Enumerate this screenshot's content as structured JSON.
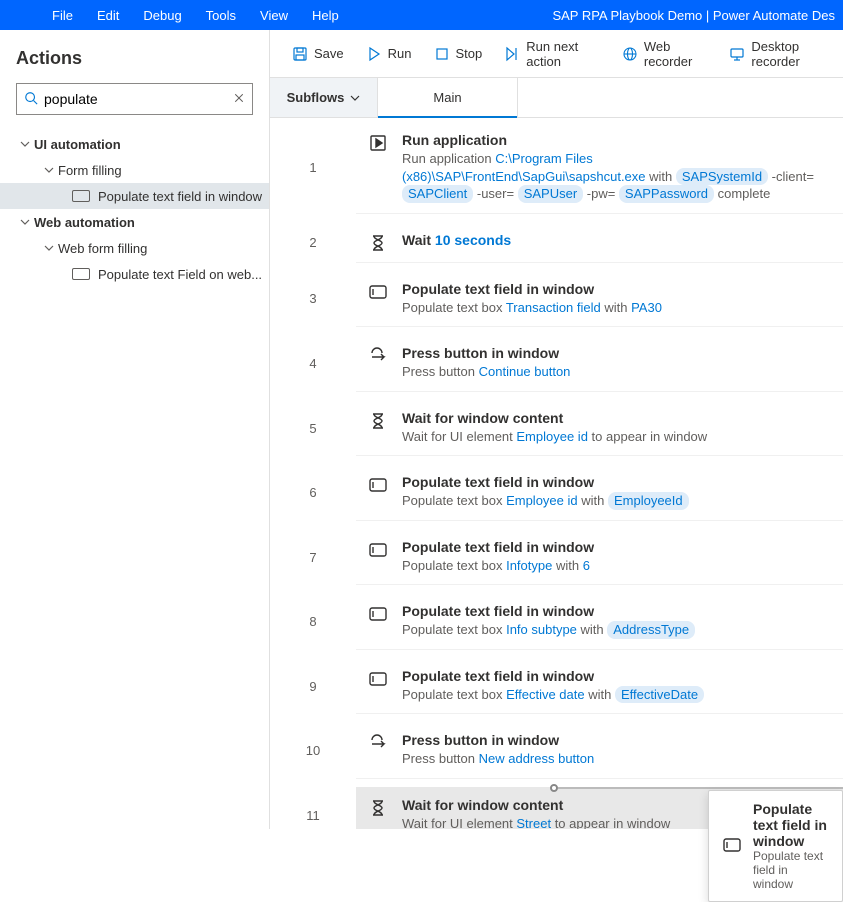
{
  "title": "SAP RPA Playbook Demo | Power Automate Des",
  "menu": [
    "File",
    "Edit",
    "Debug",
    "Tools",
    "View",
    "Help"
  ],
  "sidebar": {
    "header": "Actions",
    "search_value": "populate",
    "tree": {
      "g1": "UI automation",
      "g1s1": "Form filling",
      "g1s1l1": "Populate text field in window",
      "g2": "Web automation",
      "g2s1": "Web form filling",
      "g2s1l1": "Populate text Field on web..."
    }
  },
  "toolbar": {
    "save": "Save",
    "run": "Run",
    "stop": "Stop",
    "run_next": "Run next action",
    "web_rec": "Web recorder",
    "desk_rec": "Desktop recorder"
  },
  "tabs": {
    "subflows": "Subflows",
    "main": "Main"
  },
  "steps": [
    {
      "n": "1",
      "icon": "play-box",
      "title": "Run application",
      "desc_pre": "Run application ",
      "link": "C:\\Program Files (x86)\\SAP\\FrontEnd\\SapGui\\sapshcut.exe",
      "desc_mid": " with ",
      "tokens": [
        "SAPSystemId",
        "SAPClient",
        "SAPUser",
        "SAPPassword"
      ],
      "inter": [
        "  -client= ",
        "  -user= ",
        "  -pw= "
      ],
      "desc_post": " complete"
    },
    {
      "n": "2",
      "icon": "hourglass",
      "title": "Wait",
      "inline_link": "10 seconds"
    },
    {
      "n": "3",
      "icon": "textbox",
      "title": "Populate text field in window",
      "desc_pre": "Populate text box ",
      "link": "Transaction field",
      "desc_mid": " with ",
      "link2": "PA30"
    },
    {
      "n": "4",
      "icon": "press",
      "title": "Press button in window",
      "desc_pre": "Press button ",
      "link": "Continue button"
    },
    {
      "n": "5",
      "icon": "hourglass",
      "title": "Wait for window content",
      "desc_pre": "Wait for UI element ",
      "link": "Employee id",
      "desc_mid": " to appear in window"
    },
    {
      "n": "6",
      "icon": "textbox",
      "title": "Populate text field in window",
      "desc_pre": "Populate text box ",
      "link": "Employee id",
      "desc_mid": " with ",
      "token": "EmployeeId"
    },
    {
      "n": "7",
      "icon": "textbox",
      "title": "Populate text field in window",
      "desc_pre": "Populate text box ",
      "link": "Infotype",
      "desc_mid": " with ",
      "link2": "6"
    },
    {
      "n": "8",
      "icon": "textbox",
      "title": "Populate text field in window",
      "desc_pre": "Populate text box ",
      "link": "Info subtype",
      "desc_mid": " with ",
      "token": "AddressType"
    },
    {
      "n": "9",
      "icon": "textbox",
      "title": "Populate text field in window",
      "desc_pre": "Populate text box ",
      "link": "Effective date",
      "desc_mid": " with ",
      "token": "EffectiveDate"
    },
    {
      "n": "10",
      "icon": "press",
      "title": "Press button in window",
      "desc_pre": "Press button ",
      "link": "New address button"
    },
    {
      "n": "11",
      "icon": "hourglass",
      "selected": true,
      "title": "Wait for window content",
      "desc_pre": "Wait for UI element ",
      "link": "Street",
      "desc_mid": " to appear in window"
    }
  ],
  "drag": {
    "title": "Populate text field in window",
    "sub": "Populate text field in window"
  }
}
